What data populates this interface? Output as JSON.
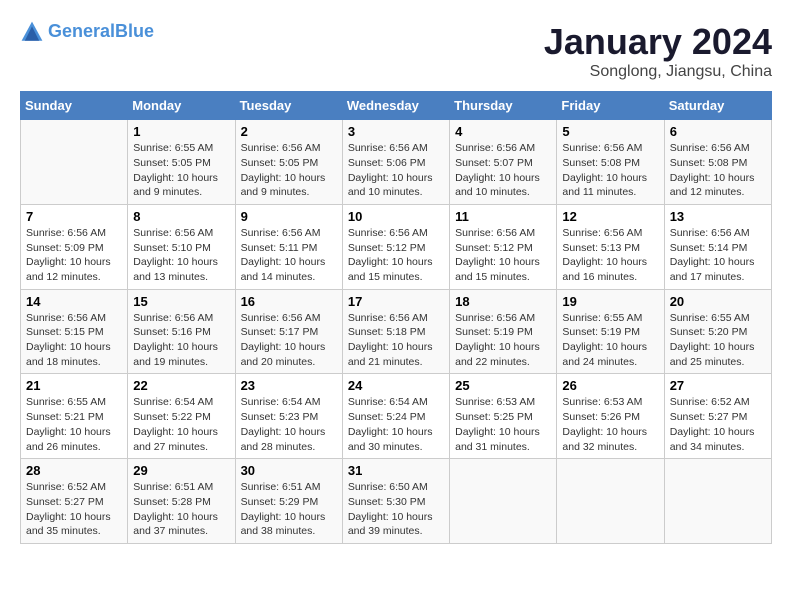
{
  "header": {
    "logo_line1": "General",
    "logo_line2": "Blue",
    "title": "January 2024",
    "subtitle": "Songlong, Jiangsu, China"
  },
  "weekdays": [
    "Sunday",
    "Monday",
    "Tuesday",
    "Wednesday",
    "Thursday",
    "Friday",
    "Saturday"
  ],
  "weeks": [
    [
      {
        "day": "",
        "info": ""
      },
      {
        "day": "1",
        "info": "Sunrise: 6:55 AM\nSunset: 5:05 PM\nDaylight: 10 hours\nand 9 minutes."
      },
      {
        "day": "2",
        "info": "Sunrise: 6:56 AM\nSunset: 5:05 PM\nDaylight: 10 hours\nand 9 minutes."
      },
      {
        "day": "3",
        "info": "Sunrise: 6:56 AM\nSunset: 5:06 PM\nDaylight: 10 hours\nand 10 minutes."
      },
      {
        "day": "4",
        "info": "Sunrise: 6:56 AM\nSunset: 5:07 PM\nDaylight: 10 hours\nand 10 minutes."
      },
      {
        "day": "5",
        "info": "Sunrise: 6:56 AM\nSunset: 5:08 PM\nDaylight: 10 hours\nand 11 minutes."
      },
      {
        "day": "6",
        "info": "Sunrise: 6:56 AM\nSunset: 5:08 PM\nDaylight: 10 hours\nand 12 minutes."
      }
    ],
    [
      {
        "day": "7",
        "info": "Sunrise: 6:56 AM\nSunset: 5:09 PM\nDaylight: 10 hours\nand 12 minutes."
      },
      {
        "day": "8",
        "info": "Sunrise: 6:56 AM\nSunset: 5:10 PM\nDaylight: 10 hours\nand 13 minutes."
      },
      {
        "day": "9",
        "info": "Sunrise: 6:56 AM\nSunset: 5:11 PM\nDaylight: 10 hours\nand 14 minutes."
      },
      {
        "day": "10",
        "info": "Sunrise: 6:56 AM\nSunset: 5:12 PM\nDaylight: 10 hours\nand 15 minutes."
      },
      {
        "day": "11",
        "info": "Sunrise: 6:56 AM\nSunset: 5:12 PM\nDaylight: 10 hours\nand 15 minutes."
      },
      {
        "day": "12",
        "info": "Sunrise: 6:56 AM\nSunset: 5:13 PM\nDaylight: 10 hours\nand 16 minutes."
      },
      {
        "day": "13",
        "info": "Sunrise: 6:56 AM\nSunset: 5:14 PM\nDaylight: 10 hours\nand 17 minutes."
      }
    ],
    [
      {
        "day": "14",
        "info": "Sunrise: 6:56 AM\nSunset: 5:15 PM\nDaylight: 10 hours\nand 18 minutes."
      },
      {
        "day": "15",
        "info": "Sunrise: 6:56 AM\nSunset: 5:16 PM\nDaylight: 10 hours\nand 19 minutes."
      },
      {
        "day": "16",
        "info": "Sunrise: 6:56 AM\nSunset: 5:17 PM\nDaylight: 10 hours\nand 20 minutes."
      },
      {
        "day": "17",
        "info": "Sunrise: 6:56 AM\nSunset: 5:18 PM\nDaylight: 10 hours\nand 21 minutes."
      },
      {
        "day": "18",
        "info": "Sunrise: 6:56 AM\nSunset: 5:19 PM\nDaylight: 10 hours\nand 22 minutes."
      },
      {
        "day": "19",
        "info": "Sunrise: 6:55 AM\nSunset: 5:19 PM\nDaylight: 10 hours\nand 24 minutes."
      },
      {
        "day": "20",
        "info": "Sunrise: 6:55 AM\nSunset: 5:20 PM\nDaylight: 10 hours\nand 25 minutes."
      }
    ],
    [
      {
        "day": "21",
        "info": "Sunrise: 6:55 AM\nSunset: 5:21 PM\nDaylight: 10 hours\nand 26 minutes."
      },
      {
        "day": "22",
        "info": "Sunrise: 6:54 AM\nSunset: 5:22 PM\nDaylight: 10 hours\nand 27 minutes."
      },
      {
        "day": "23",
        "info": "Sunrise: 6:54 AM\nSunset: 5:23 PM\nDaylight: 10 hours\nand 28 minutes."
      },
      {
        "day": "24",
        "info": "Sunrise: 6:54 AM\nSunset: 5:24 PM\nDaylight: 10 hours\nand 30 minutes."
      },
      {
        "day": "25",
        "info": "Sunrise: 6:53 AM\nSunset: 5:25 PM\nDaylight: 10 hours\nand 31 minutes."
      },
      {
        "day": "26",
        "info": "Sunrise: 6:53 AM\nSunset: 5:26 PM\nDaylight: 10 hours\nand 32 minutes."
      },
      {
        "day": "27",
        "info": "Sunrise: 6:52 AM\nSunset: 5:27 PM\nDaylight: 10 hours\nand 34 minutes."
      }
    ],
    [
      {
        "day": "28",
        "info": "Sunrise: 6:52 AM\nSunset: 5:27 PM\nDaylight: 10 hours\nand 35 minutes."
      },
      {
        "day": "29",
        "info": "Sunrise: 6:51 AM\nSunset: 5:28 PM\nDaylight: 10 hours\nand 37 minutes."
      },
      {
        "day": "30",
        "info": "Sunrise: 6:51 AM\nSunset: 5:29 PM\nDaylight: 10 hours\nand 38 minutes."
      },
      {
        "day": "31",
        "info": "Sunrise: 6:50 AM\nSunset: 5:30 PM\nDaylight: 10 hours\nand 39 minutes."
      },
      {
        "day": "",
        "info": ""
      },
      {
        "day": "",
        "info": ""
      },
      {
        "day": "",
        "info": ""
      }
    ]
  ]
}
